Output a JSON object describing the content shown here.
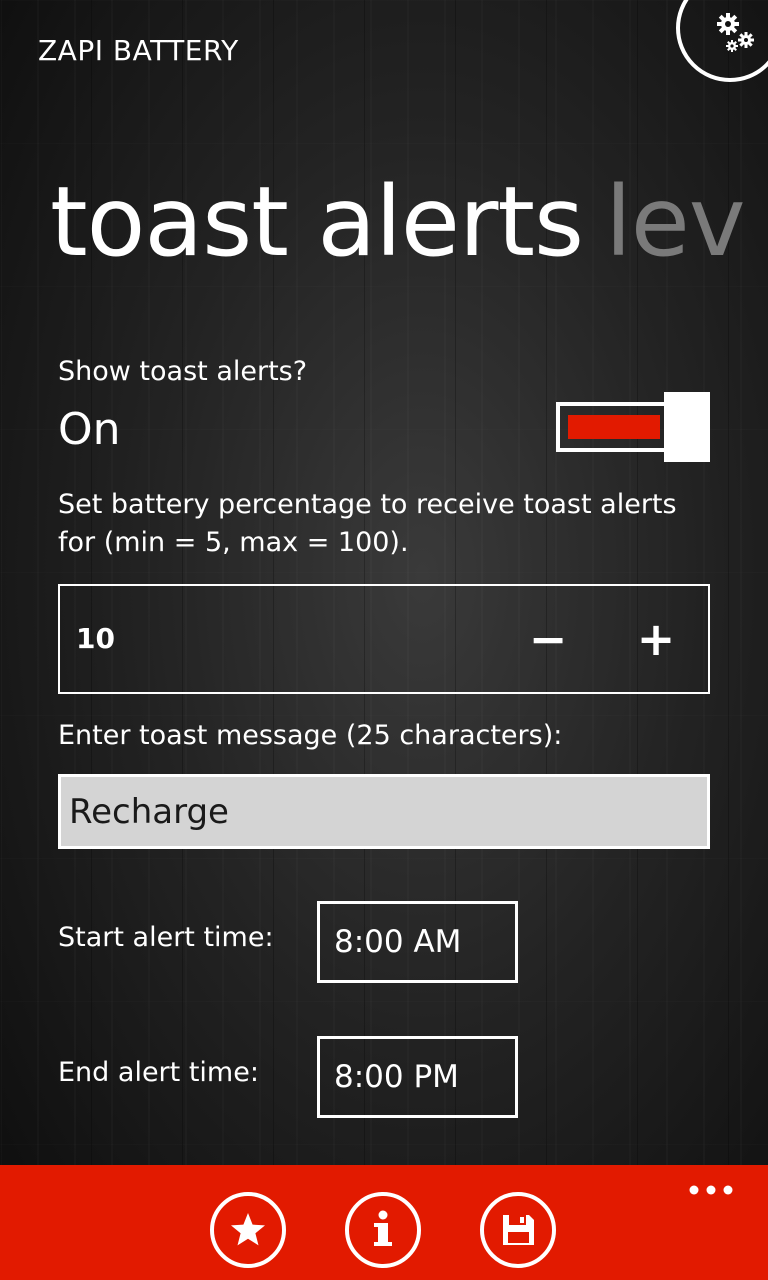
{
  "app": {
    "title": "ZAPI BATTERY"
  },
  "pivot": {
    "active": "toast alerts",
    "next": "lev"
  },
  "toast": {
    "show_label": "Show toast alerts?",
    "toggle_state": "On",
    "toggle_on": true,
    "description": "Set battery percentage to receive toast alerts for (min = 5, max = 100).",
    "percentage": "10",
    "minus_label": "−",
    "plus_label": "+",
    "message_label": "Enter toast message (25 characters):",
    "message_value": "Recharge",
    "start_label": "Start alert time:",
    "start_time": "8:00 AM",
    "end_label": "End alert time:",
    "end_time": "8:00 PM"
  },
  "appbar": {
    "icons": [
      "star-icon",
      "info-icon",
      "save-icon",
      "more-icon"
    ],
    "accent": "#e21a00"
  },
  "colors": {
    "accent": "#e21a00",
    "foreground": "#ffffff",
    "input_background": "#d4d4d4",
    "inactive_pivot": "#7a7a7a"
  }
}
